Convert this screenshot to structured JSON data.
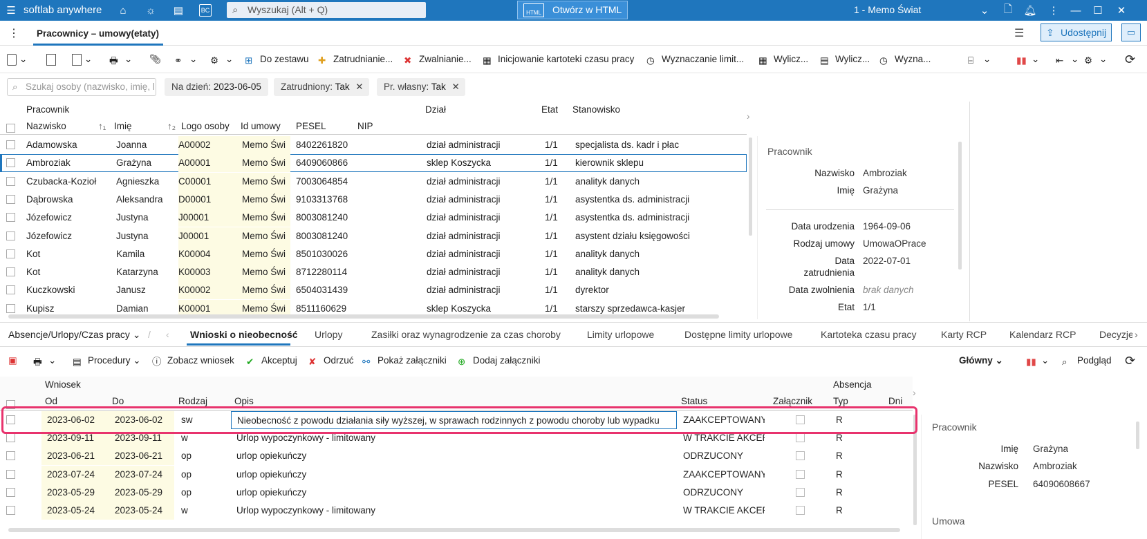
{
  "app": {
    "brand": "softlab anywhere",
    "search_placeholder": "Wyszukaj (Alt + Q)",
    "html_button": "Otwórz w HTML",
    "company": "1 - Memo Świat"
  },
  "tab": {
    "title": "Pracownicy – umowy(etaty)",
    "share": "Udostępnij"
  },
  "toolbar": {
    "to_set": "Do zestawu",
    "hire": "Zatrudnianie...",
    "dismiss": "Zwalnianie...",
    "init_card": "Inicjowanie kartoteki czasu pracy",
    "limits": "Wyznaczanie limit...",
    "calc1": "Wylicz...",
    "calc2": "Wylicz...",
    "calc3": "Wyzna..."
  },
  "filters": {
    "search_placeholder": "Szukaj osoby (nazwisko, imię, l",
    "date_label": "Na dzień:",
    "date_value": "2023-06-05",
    "employed_label": "Zatrudniony:",
    "employed_value": "Tak",
    "own_label": "Pr. własny:",
    "own_value": "Tak"
  },
  "grid": {
    "group_header": "Pracownik",
    "col_surname": "Nazwisko",
    "col_name": "Imię",
    "col_logo": "Logo osoby",
    "col_contract": "Id umowy",
    "col_pesel": "PESEL",
    "col_nip": "NIP",
    "col_dept": "Dział",
    "col_etat": "Etat",
    "col_position": "Stanowisko",
    "rows": [
      {
        "surname": "Adamowska",
        "name": "Joanna",
        "logo": "A00002",
        "contract": "Memo Świ",
        "pesel": "8402261820",
        "dept": "dział administracji",
        "etat": "1/1",
        "position": "specjalista ds. kadr i płac"
      },
      {
        "surname": "Ambroziak",
        "name": "Grażyna",
        "logo": "A00001",
        "contract": "Memo Świ",
        "pesel": "6409060866",
        "dept": "sklep Koszycka",
        "etat": "1/1",
        "position": "kierownik sklepu"
      },
      {
        "surname": "Czubacka-Kozioł",
        "name": "Agnieszka",
        "logo": "C00001",
        "contract": "Memo Świ",
        "pesel": "7003064854",
        "dept": "dział administracji",
        "etat": "1/1",
        "position": "analityk danych"
      },
      {
        "surname": "Dąbrowska",
        "name": "Aleksandra",
        "logo": "D00001",
        "contract": "Memo Świ",
        "pesel": "9103313768",
        "dept": "dział administracji",
        "etat": "1/1",
        "position": "asystentka ds. administracji"
      },
      {
        "surname": "Józefowicz",
        "name": "Justyna",
        "logo": "J00001",
        "contract": "Memo Świ",
        "pesel": "8003081240",
        "dept": "dział administracji",
        "etat": "1/1",
        "position": "asystentka ds. administracji"
      },
      {
        "surname": "Józefowicz",
        "name": "Justyna",
        "logo": "J00001",
        "contract": "Memo Świ",
        "pesel": "8003081240",
        "dept": "dział administracji",
        "etat": "1/1",
        "position": "asystent działu księgowości"
      },
      {
        "surname": "Kot",
        "name": "Kamila",
        "logo": "K00004",
        "contract": "Memo Świ",
        "pesel": "8501030026",
        "dept": "dział administracji",
        "etat": "1/1",
        "position": "analityk danych"
      },
      {
        "surname": "Kot",
        "name": "Katarzyna",
        "logo": "K00003",
        "contract": "Memo Świ",
        "pesel": "8712280114",
        "dept": "dział administracji",
        "etat": "1/1",
        "position": "analityk danych"
      },
      {
        "surname": "Kuczkowski",
        "name": "Janusz",
        "logo": "K00002",
        "contract": "Memo Świ",
        "pesel": "6504031439",
        "dept": "dział administracji",
        "etat": "1/1",
        "position": "dyrektor"
      },
      {
        "surname": "Kupisz",
        "name": "Damian",
        "logo": "K00001",
        "contract": "Memo Świ",
        "pesel": "8511160629",
        "dept": "sklep Koszycka",
        "etat": "1/1",
        "position": "starszy sprzedawca-kasjer"
      }
    ]
  },
  "side": {
    "section": "Pracownik",
    "surname_l": "Nazwisko",
    "surname_v": "Ambroziak",
    "name_l": "Imię",
    "name_v": "Grażyna",
    "dob_l": "Data urodzenia",
    "dob_v": "1964-09-06",
    "type_l": "Rodzaj umowy",
    "type_v": "UmowaOPrace",
    "hire_l1": "Data",
    "hire_l2": "zatrudnienia",
    "hire_v": "2022-07-01",
    "dism_l": "Data zwolnienia",
    "dism_v": "brak danych",
    "etat_l": "Etat",
    "etat_v": "1/1"
  },
  "bottom_tabs": {
    "group": "Absencje/Urlopy/Czas pracy",
    "t1": "Wnioski o nieobecność",
    "t2": "Urlopy",
    "t3": "Zasiłki oraz wynagrodzenie za czas choroby",
    "t4": "Limity urlopowe",
    "t5": "Dostępne limity urlopowe",
    "t6": "Kartoteka czasu pracy",
    "t7": "Karty RCP",
    "t8": "Kalendarz RCP",
    "t9": "Decyzje"
  },
  "toolbar2": {
    "procedures": "Procedury",
    "view": "Zobacz wniosek",
    "accept": "Akceptuj",
    "reject": "Odrzuć",
    "show_att": "Pokaż załączniki",
    "add_att": "Dodaj załączniki",
    "main": "Główny",
    "preview": "Podgląd"
  },
  "grid2": {
    "group1": "Wniosek",
    "group2": "Absencja",
    "col_from": "Od",
    "col_to": "Do",
    "col_kind": "Rodzaj",
    "col_desc": "Opis",
    "col_status": "Status",
    "col_att": "Załącznik",
    "col_type": "Typ",
    "col_days": "Dni",
    "rows": [
      {
        "from": "2023-06-02",
        "to": "2023-06-02",
        "kind": "sw",
        "desc": "Nieobecność z powodu działania siły wyższej, w sprawach rodzinnych z powodu choroby lub wypadku",
        "status": "ZAAKCEPTOWANY",
        "type": "R"
      },
      {
        "from": "2023-09-11",
        "to": "2023-09-11",
        "kind": "w",
        "desc": "Urlop wypoczynkowy - limitowany",
        "status": "W TRAKCIE AKCEPT",
        "type": "R"
      },
      {
        "from": "2023-06-21",
        "to": "2023-06-21",
        "kind": "op",
        "desc": "urlop opiekuńczy",
        "status": "ODRZUCONY",
        "type": "R"
      },
      {
        "from": "2023-07-24",
        "to": "2023-07-24",
        "kind": "op",
        "desc": "urlop opiekuńczy",
        "status": "ZAAKCEPTOWANY",
        "type": "R"
      },
      {
        "from": "2023-05-29",
        "to": "2023-05-29",
        "kind": "op",
        "desc": "urlop opiekuńczy",
        "status": "ODRZUCONY",
        "type": "R"
      },
      {
        "from": "2023-05-24",
        "to": "2023-05-24",
        "kind": "w",
        "desc": "Urlop wypoczynkowy - limitowany",
        "status": "W TRAKCIE AKCEPT",
        "type": "R"
      }
    ]
  },
  "side2": {
    "section": "Pracownik",
    "name_l": "Imię",
    "name_v": "Grażyna",
    "surname_l": "Nazwisko",
    "surname_v": "Ambroziak",
    "pesel_l": "PESEL",
    "pesel_v": "64090608667",
    "contract": "Umowa"
  },
  "colors": {
    "brand": "#1f76bd",
    "highlight": "#e8336d",
    "logo_col": "#fdfbe3"
  }
}
